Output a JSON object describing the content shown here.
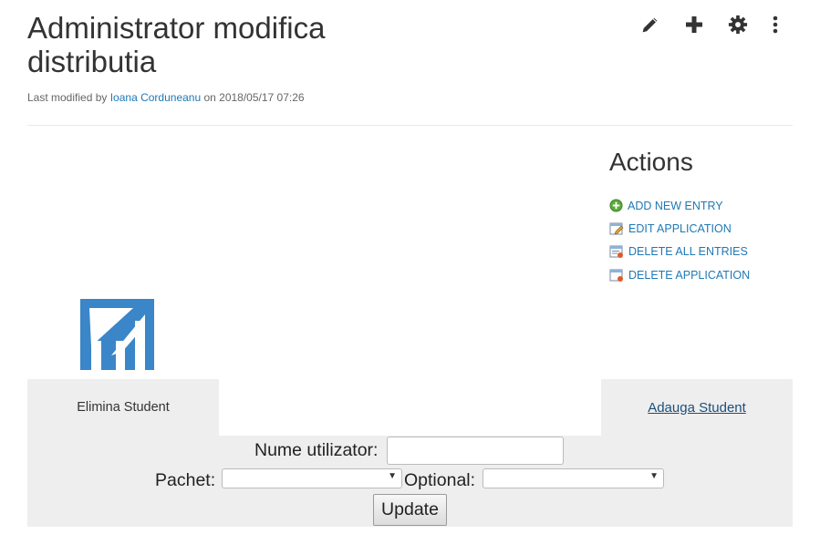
{
  "header": {
    "title": "Administrator modifica distributia",
    "modified_prefix": "Last modified by ",
    "modified_author": "Ioana Corduneanu",
    "modified_suffix": " on 2018/05/17 07:26"
  },
  "toolbar": {
    "icons": [
      "pencil-icon",
      "plus-icon",
      "gear-icon",
      "more-vertical-icon"
    ]
  },
  "actions": {
    "title": "Actions",
    "items": [
      {
        "label": "ADD NEW ENTRY",
        "icon": "add-entry-icon"
      },
      {
        "label": "EDIT APPLICATION",
        "icon": "edit-application-icon"
      },
      {
        "label": "DELETE ALL ENTRIES",
        "icon": "delete-entries-icon"
      },
      {
        "label": "DELETE APPLICATION",
        "icon": "delete-application-icon"
      }
    ]
  },
  "logo": {
    "icon": "faculty-logo",
    "color": "#3a86c8"
  },
  "tabs": {
    "left": "Elimina Student",
    "right": "Adauga Student"
  },
  "form": {
    "username_label": "Nume utilizator:",
    "username_value": "",
    "package_label": "Pachet:",
    "package_value": "",
    "optional_label": "Optional:",
    "optional_value": "",
    "submit_label": "Update"
  },
  "colors": {
    "link": "#1f78b4",
    "panel_bg": "#eeeeee",
    "tab_link": "#1d4e7a"
  }
}
